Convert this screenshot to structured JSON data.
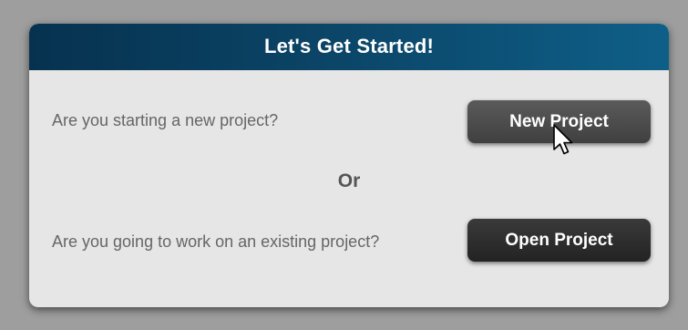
{
  "dialog": {
    "title": "Let's Get Started!",
    "new_prompt": "Are you starting a new project?",
    "new_button_label": "New Project",
    "separator": "Or",
    "open_prompt": "Are you going to work on an existing project?",
    "open_button_label": "Open Project"
  },
  "colors": {
    "header_start": "#06324f",
    "header_end": "#0e5f88",
    "dialog_bg": "#e6e6e6",
    "button_dark": "#2f2f2f"
  },
  "icons": {
    "cursor": "pointer-arrow-icon"
  }
}
